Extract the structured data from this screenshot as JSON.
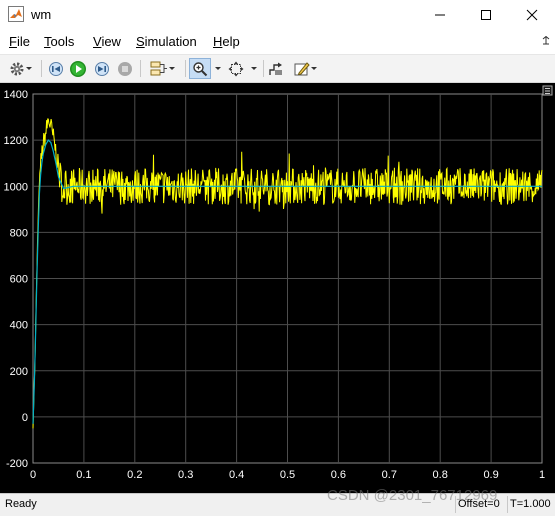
{
  "window": {
    "title": "wm"
  },
  "menu": [
    {
      "label": "File",
      "underline": "F",
      "rest": "ile"
    },
    {
      "label": "Tools",
      "underline": "T",
      "rest": "ools"
    },
    {
      "label": "View",
      "underline": "V",
      "rest": "iew"
    },
    {
      "label": "Simulation",
      "underline": "S",
      "rest": "imulation"
    },
    {
      "label": "Help",
      "underline": "H",
      "rest": "elp"
    }
  ],
  "colors": {
    "axes_bg": "#000000",
    "grid": "#4d4d4d",
    "tick_text": "#ffffff",
    "signal_noisy": "#ffff00",
    "signal_ref": "#00b0c8",
    "toolbar_accent": "#c6ddf5"
  },
  "toolbar_icons": [
    "gear-icon",
    "step-back-icon",
    "run-icon",
    "step-forward-icon",
    "stop-icon",
    "signal-selector-icon",
    "zoom-icon",
    "fit-to-view-icon",
    "triggers-icon",
    "style-icon"
  ],
  "chart_data": {
    "type": "line",
    "title": "",
    "xlabel": "",
    "ylabel": "",
    "xlim": [
      0,
      1
    ],
    "ylim": [
      -200,
      1400
    ],
    "x_ticks": [
      "0",
      "0.1",
      "0.2",
      "0.3",
      "0.4",
      "0.5",
      "0.6",
      "0.7",
      "0.8",
      "0.9",
      "1"
    ],
    "y_ticks": [
      "1400",
      "1200",
      "1000",
      "800",
      "600",
      "400",
      "200",
      "0",
      "-200"
    ],
    "grid": true,
    "series": [
      {
        "color": "#ffff00",
        "x": [
          0,
          0.004,
          0.008,
          0.012,
          0.016,
          0.02,
          0.025,
          0.03,
          0.035,
          0.04,
          0.045,
          0.05,
          0.055,
          0.06,
          0.07,
          0.08,
          0.1,
          0.2,
          0.3,
          0.4,
          0.5,
          0.6,
          0.7,
          0.8,
          0.9,
          1.0
        ],
        "values": [
          -30,
          250,
          680,
          1000,
          1120,
          1180,
          1230,
          1290,
          1260,
          1210,
          1150,
          1080,
          1020,
          990,
          1000,
          1000,
          1000,
          1000,
          1000,
          1000,
          1000,
          1000,
          1000,
          1000,
          1000,
          1000
        ],
        "noise_amplitude_after_0_05": 80
      },
      {
        "color": "#00b0c8",
        "x": [
          0,
          0.004,
          0.008,
          0.012,
          0.016,
          0.02,
          0.025,
          0.03,
          0.035,
          0.04,
          0.045,
          0.05,
          0.06,
          0.08,
          0.1,
          0.2,
          0.3,
          0.4,
          0.5,
          0.6,
          0.7,
          0.8,
          0.9,
          1.0
        ],
        "values": [
          -30,
          240,
          640,
          950,
          1080,
          1140,
          1180,
          1200,
          1190,
          1150,
          1100,
          1040,
          990,
          1000,
          1000,
          1000,
          1000,
          1000,
          1000,
          1000,
          1000,
          1000,
          1000,
          1000
        ]
      }
    ]
  },
  "status": {
    "text": "Ready",
    "offset": "Offset=0",
    "time": "T=1.000"
  },
  "watermark": "CSDN @2301_76712969"
}
